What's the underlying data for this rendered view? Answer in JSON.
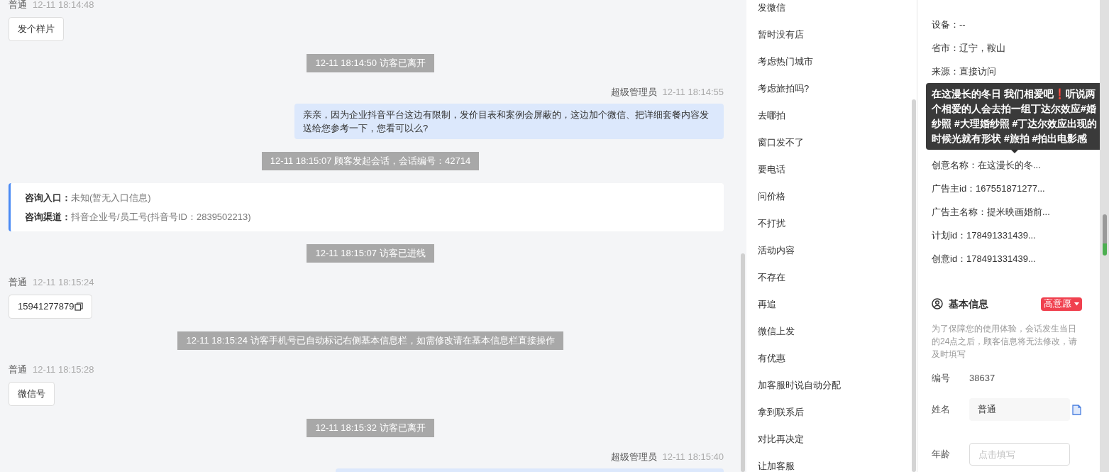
{
  "chat": {
    "messages": [
      {
        "kind": "customer",
        "sender": "普通",
        "time": "12-11 18:14:48",
        "text": "发个样片",
        "copy": false
      },
      {
        "kind": "system",
        "text": "12-11 18:14:50 访客已离开"
      },
      {
        "kind": "agent",
        "sender": "超级管理员",
        "time": "12-11 18:14:55",
        "text": "亲亲，因为企业抖音平台这边有限制，发价目表和案例会屏蔽的，这边加个微信、把详细套餐内容发送给您参考一下，您看可以么?"
      },
      {
        "kind": "system",
        "text": "12-11 18:15:07 顾客发起会话，会话编号：42714"
      },
      {
        "kind": "info",
        "rows": [
          "**咨询入口：**未知(暂无入口信息)",
          "**咨询渠道：**抖音企业号/员工号(抖音号ID：2839502213)"
        ]
      },
      {
        "kind": "system",
        "text": "12-11 18:15:07 访客已进线"
      },
      {
        "kind": "customer",
        "sender": "普通",
        "time": "12-11 18:15:24",
        "text": "15941277879",
        "copy": true
      },
      {
        "kind": "system",
        "text": "12-11 18:15:24 访客手机号已自动标记右侧基本信息栏，如需修改请在基本信息栏直接操作"
      },
      {
        "kind": "customer",
        "sender": "普通",
        "time": "12-11 18:15:28",
        "text": "微信号",
        "copy": false
      },
      {
        "kind": "system",
        "text": "12-11 18:15:32 访客已离开"
      },
      {
        "kind": "agent",
        "sender": "超级管理员",
        "time": "12-11 18:15:40"
      }
    ]
  },
  "quick_replies": [
    "发微信",
    "暂时没有店",
    "考虑热门城市",
    "考虑旅拍吗?",
    "去哪拍",
    "窗口发不了",
    "要电话",
    "问价格",
    "不打扰",
    "活动内容",
    "不存在",
    "再追",
    "微信上发",
    "有优惠",
    "加客服时说自动分配",
    "拿到联系后",
    "对比再决定",
    "让加客服"
  ],
  "source_info": {
    "rows_top": [
      "设备：--",
      "省市：辽宁，鞍山",
      "来源：直接访问"
    ],
    "rows_bottom": [
      "创意名称：在这漫长的冬...",
      "广告主id：167551871277...",
      "广告主名称：提米映画婚前...",
      "计划id：178491331439...",
      "创意id：178491331439..."
    ],
    "tooltip": "在这漫长的冬日 我们相爱吧❗听说两个相爱的人会去拍一组丁达尔效应#婚纱照 #大理婚纱照 #丁达尔效应出现的时候光就有形状 #旅拍 #拍出电影感"
  },
  "basic_info": {
    "title": "基本信息",
    "intent_tag": "高意愿",
    "notice": "为了保障您的使用体验，会话发生当日的24点之后，顾客信息将无法修改，请及时填写",
    "fields": [
      {
        "kind": "readonly",
        "label": "编号",
        "value": "38637"
      },
      {
        "kind": "text",
        "label": "姓名",
        "value": "普通"
      },
      {
        "kind": "input",
        "label": "年龄",
        "placeholder": "点击填写"
      }
    ]
  }
}
